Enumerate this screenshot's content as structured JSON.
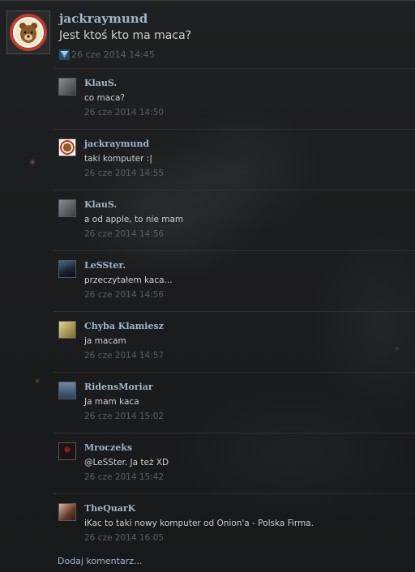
{
  "post": {
    "author": "jackraymund",
    "text": "Jest ktoś kto ma maca?",
    "time": "26 cze 2014 14:45",
    "avatar_icon": "bear-badge-icon",
    "flag_icon": "report-flag-icon"
  },
  "comments": [
    {
      "author": "KlauS.",
      "text": "co maca?",
      "time": "26 cze 2014 14:50",
      "avatar_color": "#6a6d70"
    },
    {
      "author": "jackraymund",
      "text": "taki komputer :|",
      "time": "26 cze 2014 14:55",
      "avatar_color": "#c23a2a"
    },
    {
      "author": "KlauS.",
      "text": "a od apple, to nie mam",
      "time": "26 cze 2014 14:56",
      "avatar_color": "#6a6d70"
    },
    {
      "author": "LeSSter.",
      "text": "przeczytałem kaca...",
      "time": "26 cze 2014 14:56",
      "avatar_color": "#2c3a4a"
    },
    {
      "author": "Chyba Klamiesz",
      "text": "ja macam",
      "time": "26 cze 2014 14:57",
      "avatar_color": "#b5a45a"
    },
    {
      "author": "RidensMoriar",
      "text": "Ja mam kaca",
      "time": "26 cze 2014 15:02",
      "avatar_color": "#3d5a7a"
    },
    {
      "author": "Mroczeks",
      "text": "@LeSSter. Ja też XD",
      "time": "26 cze 2014 15:42",
      "avatar_color": "#2a1a1a"
    },
    {
      "author": "TheQuarK",
      "text": "iKac to taki nowy komputer od Onion'a - Polska Firma.",
      "time": "26 cze 2014 16:05",
      "avatar_color": "#8a5a4a"
    }
  ],
  "add_comment_label": "Dodaj komentarz...",
  "colors": {
    "author": "#9cb7cc",
    "time": "#5d5e60",
    "text": "#cfcfcf",
    "background": "#1a1b1c"
  }
}
